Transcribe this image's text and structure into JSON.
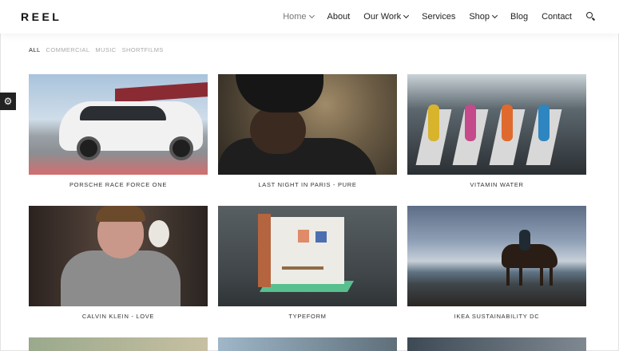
{
  "header": {
    "logo": "REEL",
    "nav": [
      {
        "label": "Home",
        "dropdown": true,
        "active": true
      },
      {
        "label": "About",
        "dropdown": false
      },
      {
        "label": "Our Work",
        "dropdown": true
      },
      {
        "label": "Services",
        "dropdown": false
      },
      {
        "label": "Shop",
        "dropdown": true
      },
      {
        "label": "Blog",
        "dropdown": false
      },
      {
        "label": "Contact",
        "dropdown": false
      }
    ],
    "search_icon": "search-icon"
  },
  "filters": [
    "ALL",
    "COMMERCIAL",
    "MUSIC",
    "SHORTFILMS"
  ],
  "active_filter": "ALL",
  "settings_icon": "gear-icon",
  "portfolio": [
    {
      "title": "PORSCHE RACE FORCE ONE"
    },
    {
      "title": "LAST NIGHT IN PARIS - PURE"
    },
    {
      "title": "VITAMIN WATER"
    },
    {
      "title": "CALVIN KLEIN - LOVE"
    },
    {
      "title": "TYPEFORM"
    },
    {
      "title": "IKEA SUSTAINABILITY DC"
    }
  ],
  "colors": {
    "text": "#222222",
    "muted": "#aaaaaa",
    "nav_active": "#777777",
    "settings_bg": "#222222"
  }
}
